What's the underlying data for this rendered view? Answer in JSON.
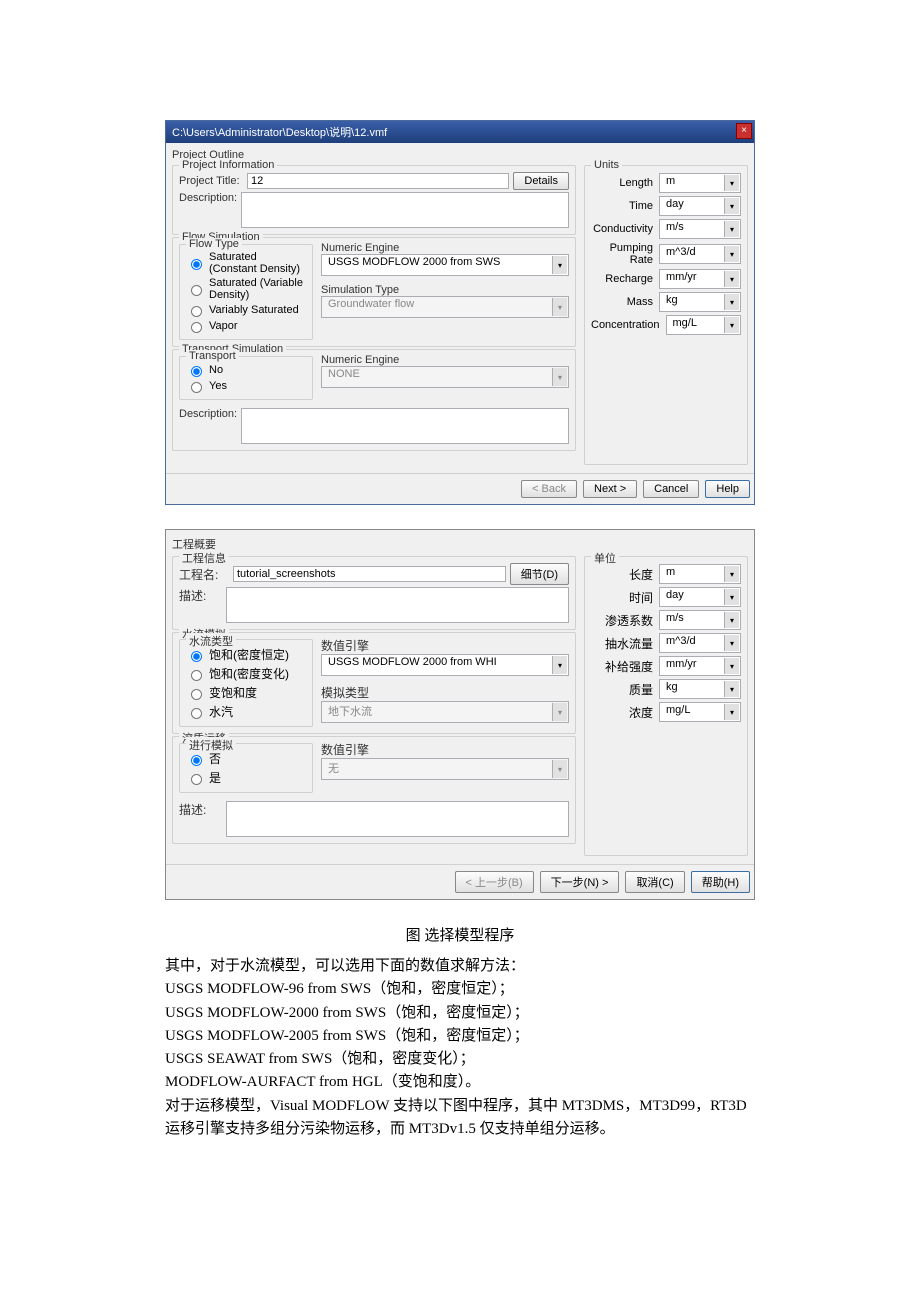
{
  "d1": {
    "title": "C:\\Users\\Administrator\\Desktop\\说明\\12.vmf",
    "outline": "Project Outline",
    "pi": {
      "leg": "Project Information",
      "tLbl": "Project Title:",
      "tVal": "12",
      "det": "Details",
      "descLbl": "Description:"
    },
    "fs": {
      "leg": "Flow Simulation",
      "ft": "Flow Type",
      "ne": "Numeric Engine",
      "st": "Simulation Type",
      "o1": "Saturated (Constant Density)",
      "o2": "Saturated (Variable Density)",
      "o3": "Variably Saturated",
      "o4": "Vapor",
      "neVal": "USGS MODFLOW 2000 from SWS",
      "stVal": "Groundwater flow"
    },
    "ts": {
      "leg": "Transport Simulation",
      "tr": "Transport",
      "ne": "Numeric Engine",
      "no": "No",
      "yes": "Yes",
      "neVal": "NONE",
      "descLbl": "Description:"
    },
    "un": {
      "leg": "Units",
      "rows": [
        [
          "Length",
          "m"
        ],
        [
          "Time",
          "day"
        ],
        [
          "Conductivity",
          "m/s"
        ],
        [
          "Pumping Rate",
          "m^3/d"
        ],
        [
          "Recharge",
          "mm/yr"
        ],
        [
          "Mass",
          "kg"
        ],
        [
          "Concentration",
          "mg/L"
        ]
      ]
    },
    "b": {
      "bk": "< Back",
      "nx": "Next >",
      "cn": "Cancel",
      "hp": "Help"
    }
  },
  "d2": {
    "outline": "工程概要",
    "pi": {
      "leg": "工程信息",
      "tLbl": "工程名:",
      "tVal": "tutorial_screenshots",
      "det": "细节(D)",
      "descLbl": "描述:"
    },
    "fs": {
      "leg": "水流模拟",
      "ft": "水流类型",
      "ne": "数值引擎",
      "st": "模拟类型",
      "o1": "饱和(密度恒定)",
      "o2": "饱和(密度变化)",
      "o3": "变饱和度",
      "o4": "水汽",
      "neVal": "USGS MODFLOW 2000 from WHI",
      "stVal": "地下水流"
    },
    "ts": {
      "leg": "溶质运移",
      "tr": "进行模拟",
      "ne": "数值引擎",
      "no": "否",
      "yes": "是",
      "neVal": "无",
      "descLbl": "描述:"
    },
    "un": {
      "leg": "单位",
      "rows": [
        [
          "长度",
          "m"
        ],
        [
          "时间",
          "day"
        ],
        [
          "渗透系数",
          "m/s"
        ],
        [
          "抽水流量",
          "m^3/d"
        ],
        [
          "补给强度",
          "mm/yr"
        ],
        [
          "质量",
          "kg"
        ],
        [
          "浓度",
          "mg/L"
        ]
      ]
    },
    "b": {
      "bk": "< 上一步(B)",
      "nx": "下一步(N) >",
      "cn": "取消(C)",
      "hp": "帮助(H)"
    }
  },
  "cap": "图 选择模型程序",
  "txt": [
    "其中，对于水流模型，可以选用下面的数值求解方法：",
    "USGS MODFLOW-96 from SWS（饱和，密度恒定）；",
    "USGS MODFLOW-2000 from SWS（饱和，密度恒定）；",
    "USGS MODFLOW-2005 from SWS（饱和，密度恒定）；",
    "USGS SEAWAT from SWS（饱和，密度变化）；",
    "MODFLOW-AURFACT from HGL（变饱和度）。",
    "对于运移模型，Visual MODFLOW 支持以下图中程序，其中 MT3DMS，MT3D99，RT3D 运移引擎支持多组分污染物运移，而 MT3Dv1.5 仅支持单组分运移。"
  ]
}
